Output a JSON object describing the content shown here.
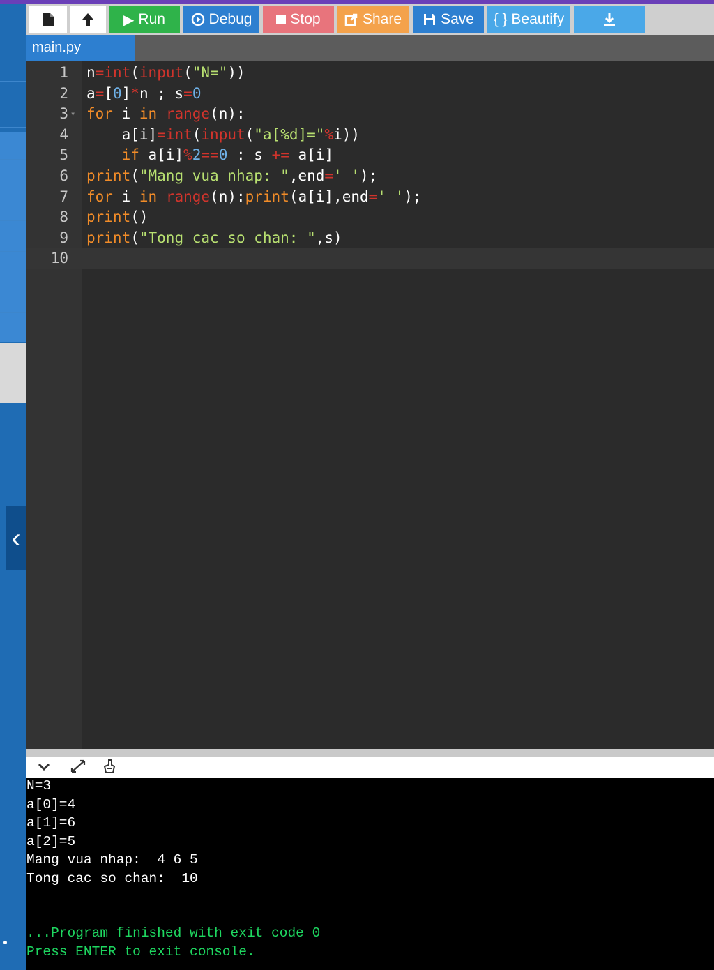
{
  "toolbar": {
    "new_icon": "file-icon",
    "upload_icon": "upload-icon",
    "run_label": "Run",
    "debug_label": "Debug",
    "stop_label": "Stop",
    "share_label": "Share",
    "save_label": "Save",
    "beautify_label": "{ } Beautify",
    "download_icon": "download-icon"
  },
  "tab": {
    "label": "main.py"
  },
  "editor": {
    "line_numbers": [
      "1",
      "2",
      "3",
      "4",
      "5",
      "6",
      "7",
      "8",
      "9",
      "10"
    ]
  },
  "console": {
    "lines": [
      "N=3",
      "a[0]=4",
      "a[1]=6",
      "a[2]=5",
      "Mang vua nhap:  4 6 5",
      "Tong cac so chan:  10"
    ],
    "finished": "...Program finished with exit code 0",
    "prompt": "Press ENTER to exit console."
  },
  "colors": {
    "run": "#2fb34a",
    "debug": "#2d7fd0",
    "stop": "#e8747c",
    "share": "#f4a24b",
    "save": "#2d7fd0",
    "beautify": "#4aa8e8",
    "console_green": "#1ed760"
  }
}
